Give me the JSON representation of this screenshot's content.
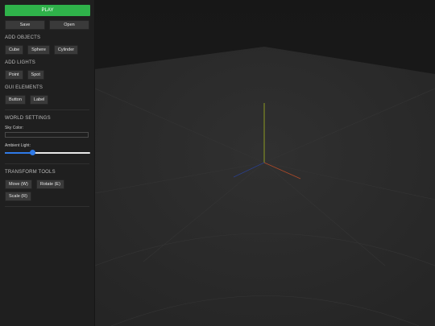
{
  "toolbar": {
    "play_label": "PLAY",
    "save_label": "Save",
    "open_label": "Open"
  },
  "add_objects": {
    "title": "ADD OBJECTS",
    "cube": "Cube",
    "sphere": "Sphere",
    "cylinder": "Cylinder"
  },
  "add_lights": {
    "title": "ADD LIGHTS",
    "point": "Point",
    "spot": "Spot"
  },
  "gui_elements": {
    "title": "GUI ELEMENTS",
    "button": "Button",
    "label": "Label"
  },
  "world_settings": {
    "title": "WORLD SETTINGS",
    "sky_color_label": "Sky Color:",
    "sky_color_value": "#1f1f1f",
    "ambient_light_label": "Ambient Light:",
    "ambient_light_value": 0.33
  },
  "transform_tools": {
    "title": "TRANSFORM TOOLS",
    "move": "Move (W)",
    "rotate": "Rotate (E)",
    "scale": "Scale (R)"
  },
  "colors": {
    "play": "#2fb24a",
    "slider_accent": "#2f7ae8",
    "axis_x": "#b04a28",
    "axis_y": "#8c9a22",
    "axis_z": "#2a3f8a"
  },
  "icons": [
    "slider-thumb",
    "axis-gizmo"
  ]
}
